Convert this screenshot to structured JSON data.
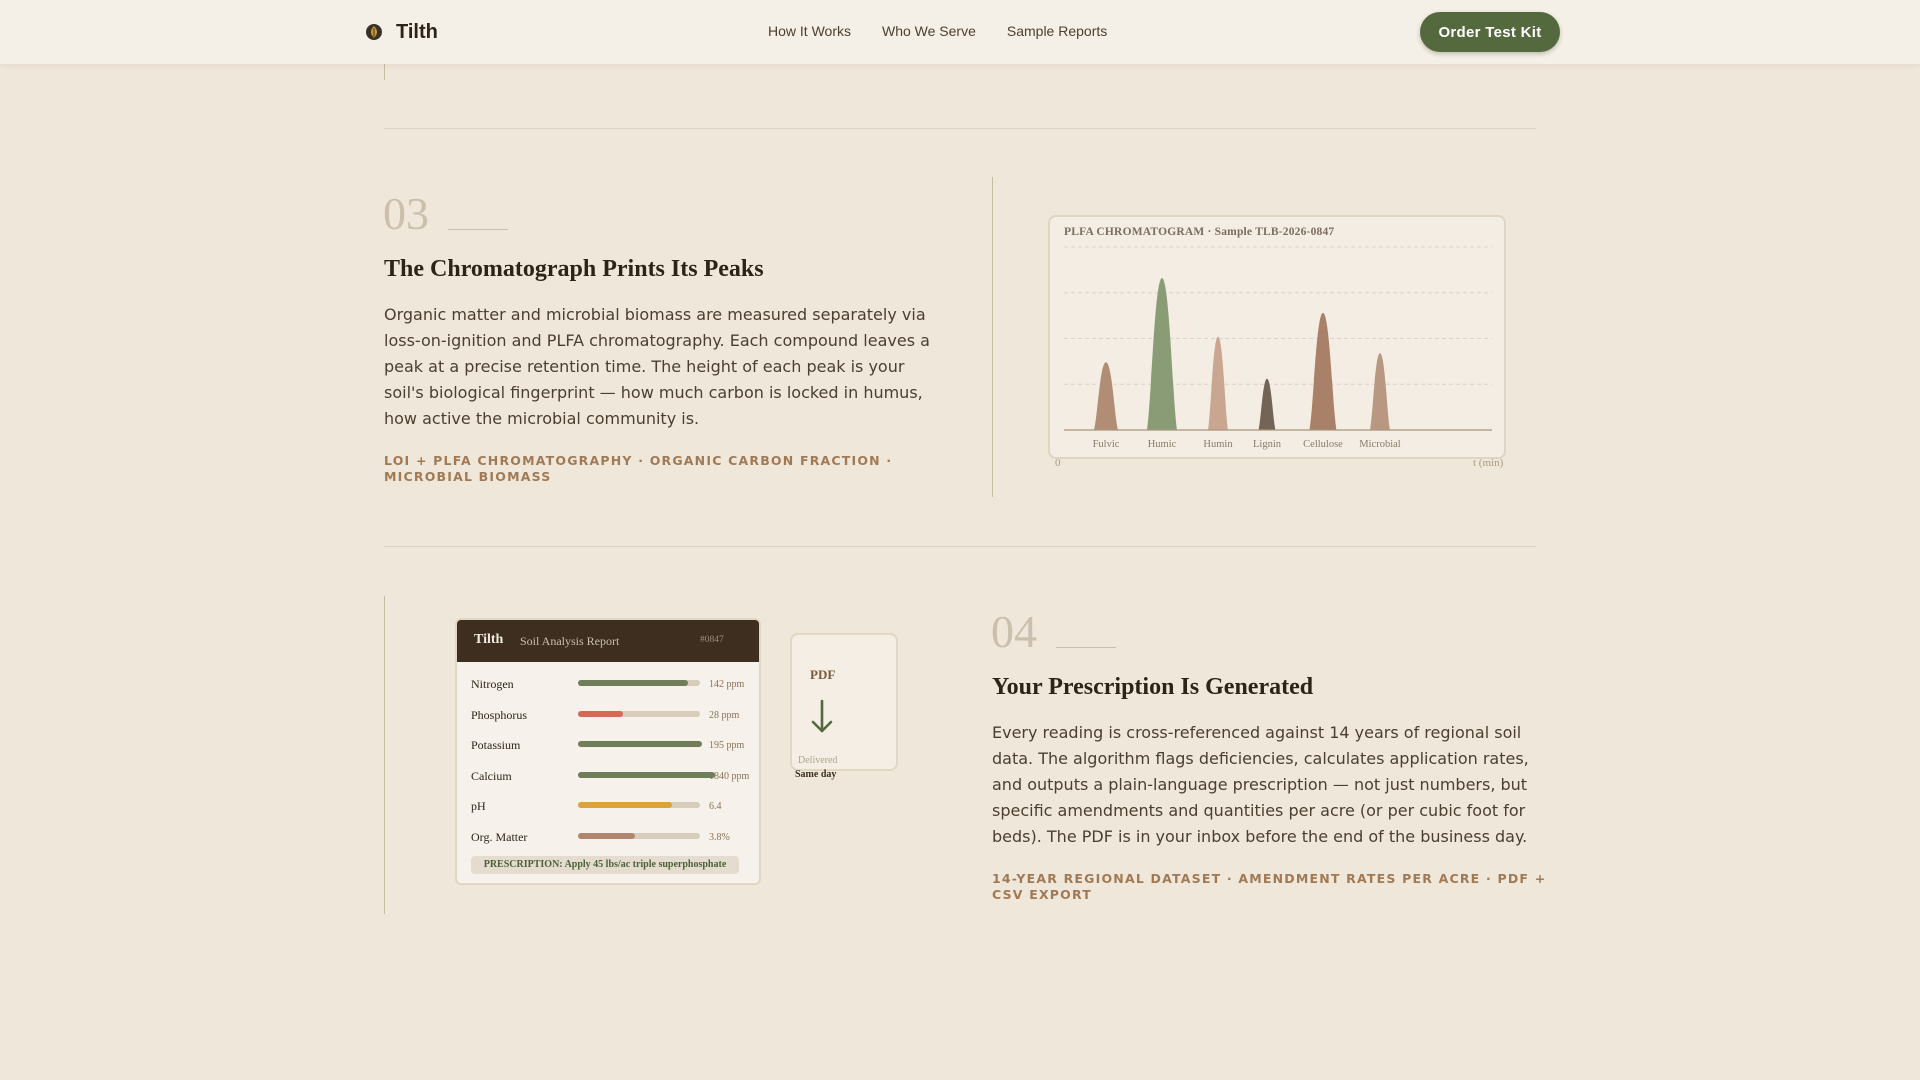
{
  "nav": {
    "brand": "Tilth",
    "links": [
      "How It Works",
      "Who We Serve",
      "Sample Reports"
    ],
    "cta": "Order Test Kit"
  },
  "step3": {
    "number": "03",
    "title": "The Chromatograph Prints Its Peaks",
    "body": "Organic matter and microbial biomass are measured separately via loss-on-ignition and PLFA chromatography. Each compound leaves a peak at a precise retention time. The height of each peak is your soil's biological fingerprint — how much carbon is locked in humus, how active the microbial community is.",
    "tags": "LOI + PLFA CHROMATOGRAPHY · ORGANIC CARBON FRACTION · MICROBIAL BIOMASS"
  },
  "chart_data": {
    "type": "area",
    "title": "PLFA CHROMATOGRAM · Sample TLB-2026-0847",
    "categories": [
      "Fulvic",
      "Humic",
      "Humin",
      "Lignin",
      "Cellulose",
      "Microbial"
    ],
    "values": [
      37,
      83,
      51,
      28,
      64,
      42
    ],
    "colors": [
      "#b08d74",
      "#8a9c76",
      "#c9a68f",
      "#726558",
      "#a98169",
      "#b99882"
    ],
    "x_start_label": "0",
    "x_end_label": "t (min)",
    "ylim": [
      0,
      100
    ],
    "grid": true
  },
  "step4": {
    "number": "04",
    "title": "Your Prescription Is Generated",
    "body": "Every reading is cross-referenced against 14 years of regional soil data. The algorithm flags deficiencies, calculates application rates, and outputs a plain-language prescription — not just numbers, but specific amendments and quantities per acre (or per cubic foot for beds). The PDF is in your inbox before the end of the business day.",
    "tags": "14-YEAR REGIONAL DATASET · AMENDMENT RATES PER ACRE · PDF + CSV EXPORT"
  },
  "report": {
    "brand": "Tilth",
    "subtitle": "Soil Analysis Report",
    "id": "#0847",
    "rows": [
      {
        "name": "Nitrogen",
        "value": "142 ppm",
        "level": 0.9,
        "color": "#6f7d58"
      },
      {
        "name": "Phosphorus",
        "value": "28 ppm",
        "level": 0.37,
        "color": "#d46a55"
      },
      {
        "name": "Potassium",
        "value": "195 ppm",
        "level": 1.02,
        "color": "#6f7d58"
      },
      {
        "name": "Calcium",
        "value": "1840 ppm",
        "level": 1.12,
        "color": "#6f7d58"
      },
      {
        "name": "pH",
        "value": "6.4",
        "level": 0.77,
        "color": "#e0a13b"
      },
      {
        "name": "Org. Matter",
        "value": "3.8%",
        "level": 0.47,
        "color": "#b08670"
      }
    ],
    "prescription": "PRESCRIPTION: Apply 45 lbs/ac triple superphosphate"
  },
  "pdf": {
    "label": "PDF",
    "delivered": "Delivered",
    "same_day": "Same day"
  }
}
